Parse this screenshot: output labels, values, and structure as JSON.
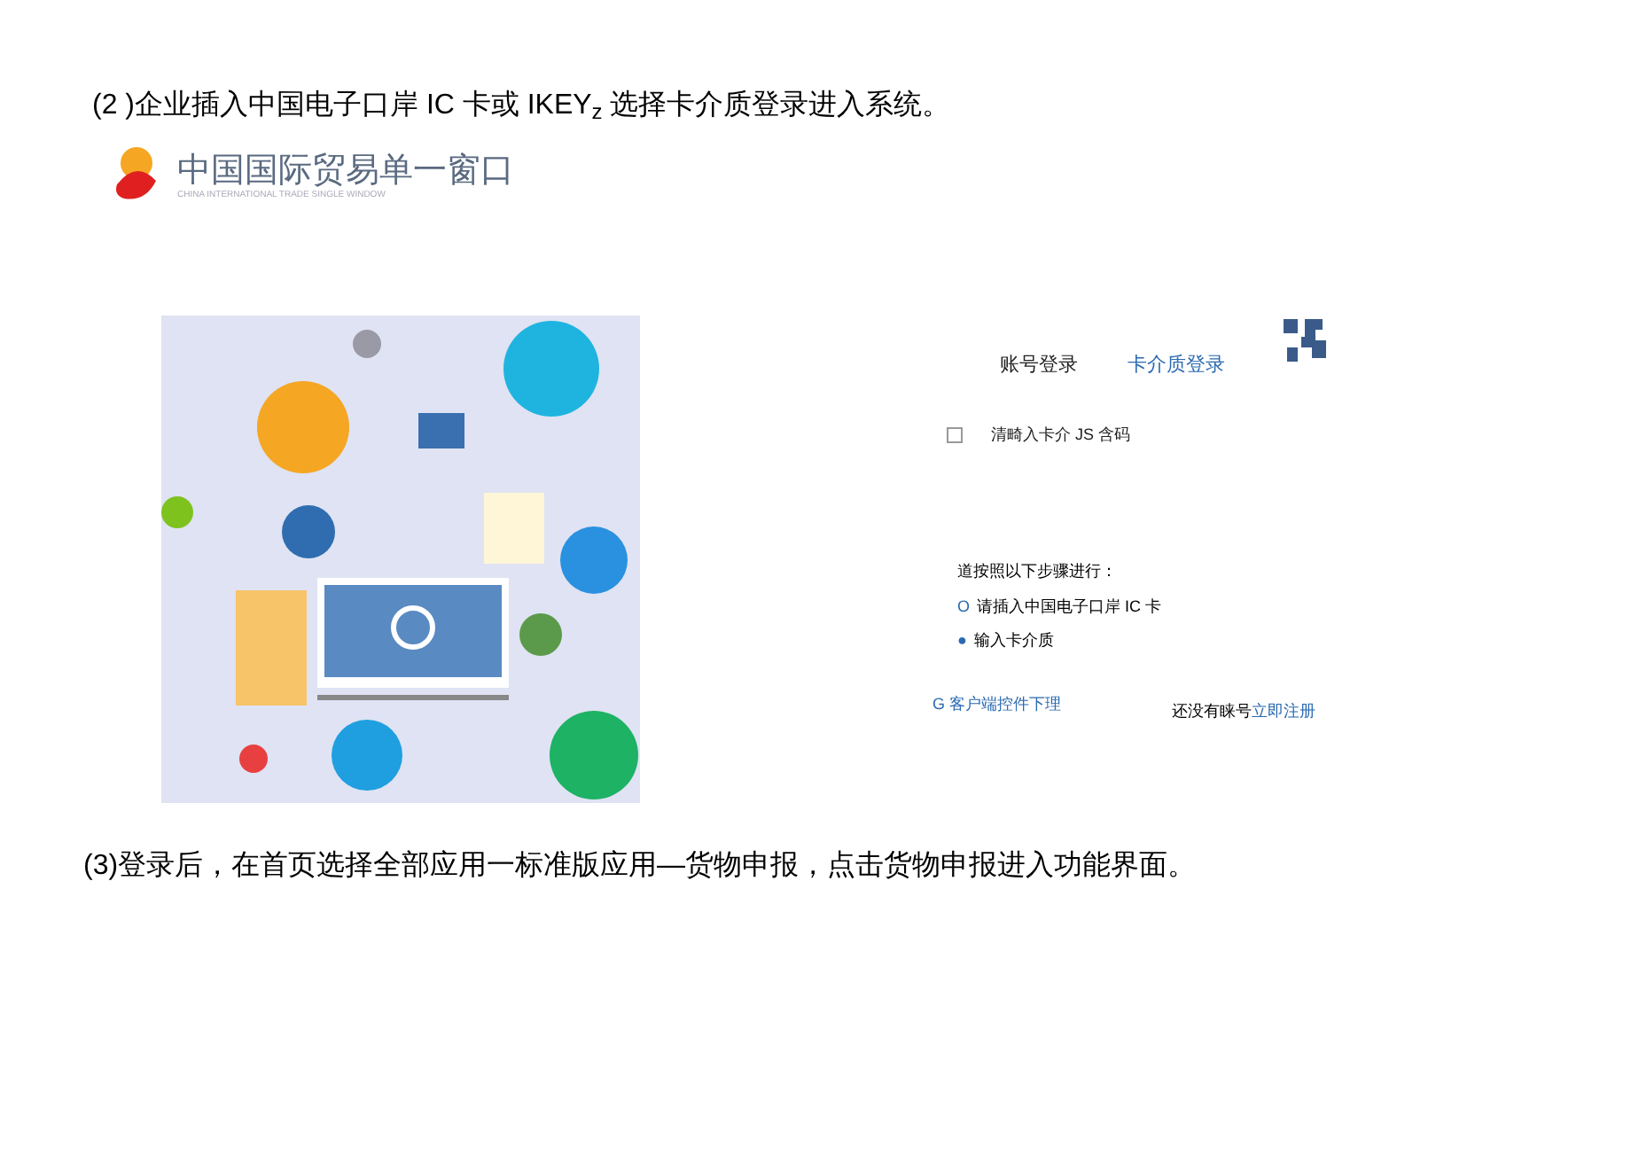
{
  "step_2": {
    "text": "(2 )企业插入中国电子口岸 IC 卡或 IKEY$_{z}$ 选择卡介质登录进入系统。"
  },
  "logo": {
    "title": "中国国际贸易单一窗口",
    "subtitle": "CHINA INTERNATIONAL TRADE SINGLE WINDOW"
  },
  "login": {
    "tabs": [
      {
        "label": "账号登录",
        "selected": false
      },
      {
        "label": "卡介质登录",
        "selected": true
      }
    ],
    "password_field": {
      "placeholder": "清畸入卡介 JS 含码"
    },
    "instructions": {
      "heading": "道按照以下步骤进行：",
      "steps": [
        {
          "marker": "O",
          "text": "请插入中国电子口岸 IC 卡"
        },
        {
          "marker": "●",
          "text": "输入卡介质"
        }
      ]
    },
    "client_link": "G 客户端控件下理",
    "register_prompt": "还没有睐号",
    "register_link": "立即注册"
  },
  "step_3": {
    "text": "(3)登录后，在首页选择全部应用一标准版应用—货物申报，点击货物申报进入功能界面。"
  }
}
